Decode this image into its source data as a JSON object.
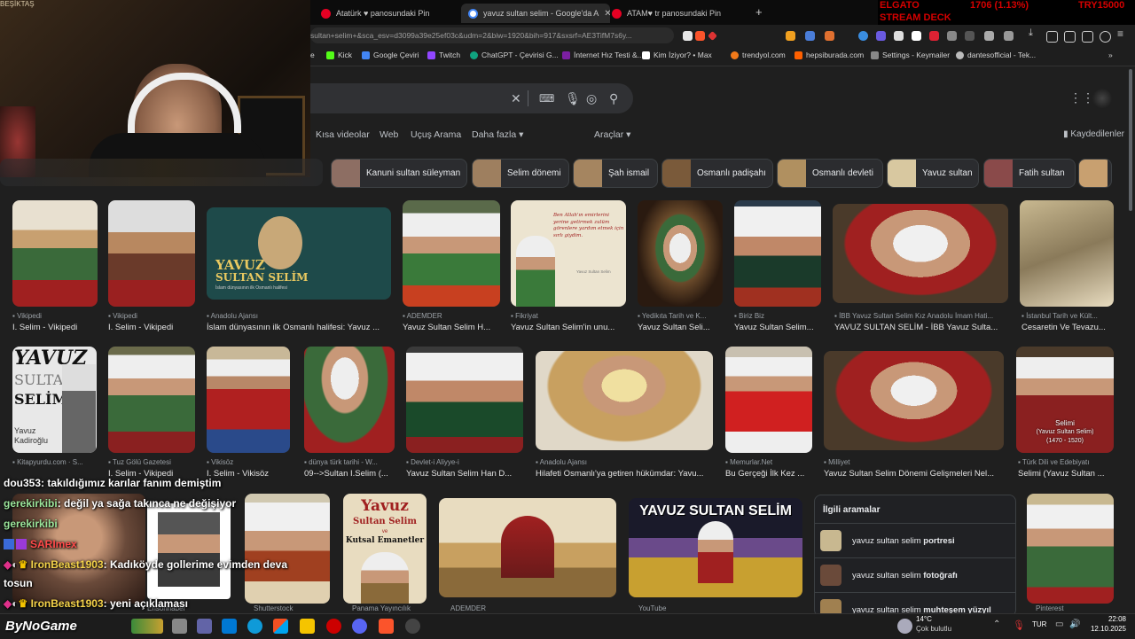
{
  "tabs": [
    {
      "title": "Atatürk ♥ panosundaki Pin",
      "color": "#e60023"
    },
    {
      "title": "yavuz sultan selim - Google'da A",
      "color": "#4285f4"
    },
    {
      "title": "ATAM♥ tr panosundaki Pin",
      "color": "#e60023"
    }
  ],
  "stock": {
    "label": "ELGATO",
    "value": "1706 (1.13%)",
    "currency": "TRY15000",
    "sub": "STREAM DECK"
  },
  "webcam_overlay": "BEŞİKTAŞ",
  "url": "sultan+selim+&sca_esv=d3099a39e25ef03c&udm=2&biw=1920&bih=917&sxsrf=AE3TifM7s6y...",
  "bookmarks": [
    {
      "label": "e",
      "color": "#444"
    },
    {
      "label": "Kick",
      "color": "#53fc18"
    },
    {
      "label": "Google Çeviri",
      "color": "#4285f4"
    },
    {
      "label": "Twitch",
      "color": "#9146ff"
    },
    {
      "label": "ChatGPT - Çevirisi G...",
      "color": "#10a37f"
    },
    {
      "label": "İnternet Hız Testi &...",
      "color": "#7b1fa2"
    },
    {
      "label": "Kim İziyor? • Max",
      "color": "#ffffff"
    },
    {
      "label": "trendyol.com",
      "color": "#f27a1a"
    },
    {
      "label": "hepsiburada.com",
      "color": "#ff6000"
    },
    {
      "label": "Settings - Keymailer",
      "color": "#888"
    },
    {
      "label": "dantesofficial - Tek...",
      "color": "#bbb"
    }
  ],
  "nav": {
    "items": [
      "Kısa videolar",
      "Web",
      "Uçuş Arama",
      "Daha fazla ▾"
    ],
    "tools": "Araçlar ▾",
    "saved": "Kaydedilenler"
  },
  "chips": [
    {
      "label": "Kanuni sultan süleyman",
      "color": "#8d6e63"
    },
    {
      "label": "Selim dönemi",
      "color": "#9e7f5f"
    },
    {
      "label": "Şah ismail",
      "color": "#a58560"
    },
    {
      "label": "Osmanlı padişahı",
      "color": "#7a5a3a"
    },
    {
      "label": "Osmanlı devleti",
      "color": "#b09060"
    },
    {
      "label": "Yavuz sultan",
      "color": "#d8c8a0"
    },
    {
      "label": "Fatih sultan",
      "color": "#8a4a4a"
    },
    {
      "label": "",
      "color": "#c8a070"
    }
  ],
  "row1": [
    {
      "src": "Vikipedi",
      "cap": "I. Selim - Vikipedi",
      "bg": "#6a7a5a"
    },
    {
      "src": "Vikipedi",
      "cap": "I. Selim - Vikipedi",
      "bg": "#7a6a5a"
    },
    {
      "src": "Anadolu Ajansı",
      "cap": "İslam dünyasının ilk Osmanlı halifesi: Yavuz ...",
      "bg": "#1e4a4a"
    },
    {
      "src": "ADEMDER",
      "cap": "Yavuz Sultan Selim H...",
      "bg": "#4a6a3a"
    },
    {
      "src": "Fikriyat",
      "cap": "Yavuz Sultan Selim'in unu...",
      "bg": "#e8e0c8"
    },
    {
      "src": "Yedikıta Tarih ve K...",
      "cap": "Yavuz Sultan Seli...",
      "bg": "#5a4a3a"
    },
    {
      "src": "Biriz Biz",
      "cap": "Yavuz Sultan Selim...",
      "bg": "#2a3a4a"
    },
    {
      "src": "İBB Yavuz Sultan Selim Kız Anadolu İmam Hati...",
      "cap": "YAVUZ SULTAN SELİM - İBB Yavuz Sulta...",
      "bg": "#4a3a2a"
    },
    {
      "src": "İstanbul Tarih ve Kült...",
      "cap": "Cesaretin Ve Tevazu...",
      "bg": "#b0a080"
    }
  ],
  "row2": [
    {
      "src": "Kitapyurdu.com · S...",
      "cap": "",
      "bg": "#e8e8e8"
    },
    {
      "src": "Tuz Gölü Gazetesi",
      "cap": "I. Selim - Vikipedi",
      "bg": "#6a6a4a"
    },
    {
      "src": "Vikisöz",
      "cap": "I. Selim - Vikisöz",
      "bg": "#c8b898"
    },
    {
      "src": "dünya türk tarihi - W...",
      "cap": "09-->Sultan I.Selim (...",
      "bg": "#5a6a3a"
    },
    {
      "src": "Devlet-i Aliyye-i",
      "cap": "Yavuz Sultan Selim Han D...",
      "bg": "#3a3a3a"
    },
    {
      "src": "Anadolu Ajansı",
      "cap": "Hilafeti Osmanlı'ya getiren hükümdar: Yavu...",
      "bg": "#e0d8c8"
    },
    {
      "src": "Memurlar.Net",
      "cap": "Bu Gerçeği İlk Kez ...",
      "bg": "#c8c0b0"
    },
    {
      "src": "Milliyet",
      "cap": "Yavuz Sultan Selim Dönemi Gelişmeleri Nel...",
      "bg": "#5a4a3a"
    },
    {
      "src": "Türk Dili ve Edebiyatı",
      "cap": "Selimi (Yavuz Sultan ...",
      "bg": "#4a3a2a"
    }
  ],
  "row2_overlay": {
    "line1": "Selimi",
    "line2": "(Yavuz Sultan Selim)",
    "line3": "(1470 - 1520)"
  },
  "row3": [
    {
      "src": "Ensonhaber",
      "bg": "#3a3a3a"
    },
    {
      "src": "Shutterstock",
      "bg": "#d0c8b0"
    },
    {
      "src": "Panama Yayıncılık",
      "bg": "#e8dcc0"
    },
    {
      "src": "ADEMDER",
      "bg": "#b8a888"
    },
    {
      "src": "YouTube",
      "bg": "#1a1a2a"
    },
    {
      "src": "Pinterest",
      "bg": "#c8b890"
    }
  ],
  "book1": {
    "t1": "YAVUZ",
    "t2": "SULTAN",
    "t3": "SELİM",
    "t4": "Yavuz",
    "t5": "Kadiroğlu"
  },
  "book2": {
    "t1": "Yavuz",
    "t2": "Sultan Selim",
    "t3": "ve",
    "t4": "Kutsal Emanetler"
  },
  "card_quote": "Ben Allah'ın emirlerini yerine getirmek zulüm görenlere yardım etmek için sırlı giydim.",
  "card_sub": "Yavuz Sultan Selim",
  "yt_title": "YAVUZ SULTAN SELİM",
  "yavuz_card": {
    "t1": "YAVUZ",
    "t2": "SULTAN SELİM",
    "t3": "İslam dünyasının ilk Osmanlı halifesi"
  },
  "related": {
    "title": "İlgili aramalar",
    "items": [
      {
        "text": "yavuz sultan selim ",
        "bold": "portresi"
      },
      {
        "text": "yavuz sultan selim ",
        "bold": "fotoğrafı"
      },
      {
        "text": "yavuz sultan selim ",
        "bold": "muhteşem yüzyıl"
      }
    ]
  },
  "chat": [
    {
      "user": "dou353",
      "msg": ": takıldığımız karılar fanım demiştim",
      "color": "#ffffff"
    },
    {
      "user": "gerekirkibi",
      "msg": ": değil ya sağa takınca ne değişiyor",
      "color": "#9be69b"
    },
    {
      "user": "gerekirkibi",
      "msg": "",
      "color": "#9be69b"
    },
    {
      "user": "SARImex",
      "msg": "",
      "color": "#ff4a4a"
    },
    {
      "user": "IronBeast1903",
      "msg": ": Kadıköyde gollerime evimden deva",
      "color": "#f5d44a"
    },
    {
      "user": "tosun",
      "msg": "",
      "color": "#ffffff"
    },
    {
      "user": "IronBeast1903",
      "msg": ": yeni açıklaması",
      "color": "#f5d44a"
    }
  ],
  "watermark": "ByNoGame",
  "taskbar": {
    "weather": "14°C",
    "weather_sub": "Çok bulutlu",
    "lang": "TUR",
    "time": "22:08",
    "date": "12.10.2025"
  }
}
